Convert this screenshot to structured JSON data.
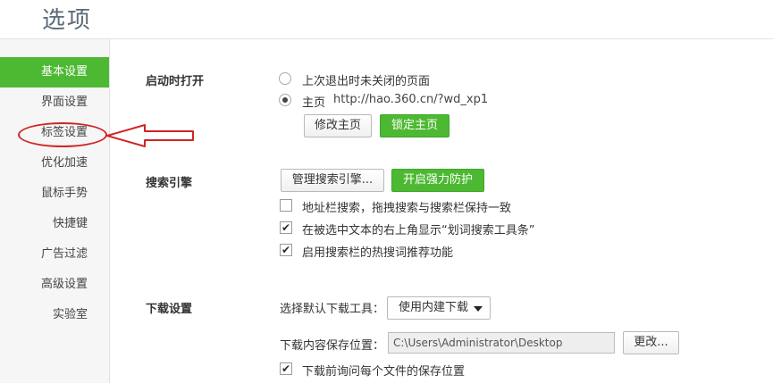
{
  "page": {
    "title": "选项"
  },
  "sidebar": {
    "items": [
      {
        "label": "基本设置"
      },
      {
        "label": "界面设置"
      },
      {
        "label": "标签设置"
      },
      {
        "label": "优化加速"
      },
      {
        "label": "鼠标手势"
      },
      {
        "label": "快捷键"
      },
      {
        "label": "广告过滤"
      },
      {
        "label": "高级设置"
      },
      {
        "label": "实验室"
      }
    ],
    "active": "基本设置",
    "highlighted": "标签设置"
  },
  "startup": {
    "title": "启动时打开",
    "option_last_session": "上次退出时未关闭的页面",
    "option_homepage": "主页",
    "homepage_url": "http://hao.360.cn/?wd_xp1",
    "selected": "主页",
    "modify_button": "修改主页",
    "lock_button": "锁定主页"
  },
  "search": {
    "title": "搜索引擎",
    "manage_button": "管理搜索引擎...",
    "protect_button": "开启强力防护",
    "options": [
      {
        "label": "地址栏搜索，拖拽搜索与搜索栏保持一致",
        "checked": false
      },
      {
        "label": "在被选中文本的右上角显示“划词搜索工具条”",
        "checked": true
      },
      {
        "label": "启用搜索栏的热搜词推荐功能",
        "checked": true
      }
    ]
  },
  "download": {
    "title": "下载设置",
    "tool_label": "选择默认下载工具：",
    "tool_value": "使用内建下载",
    "save_location_label": "下载内容保存位置：",
    "save_location_value": "C:\\Users\\Administrator\\Desktop",
    "change_button": "更改...",
    "ask_each_time": {
      "label": "下载前询问每个文件的保存位置",
      "checked": true
    }
  },
  "colors": {
    "accent_green": "#4db933",
    "annotation_red": "#d02525",
    "sidebar_bg": "#f6f6f6"
  }
}
